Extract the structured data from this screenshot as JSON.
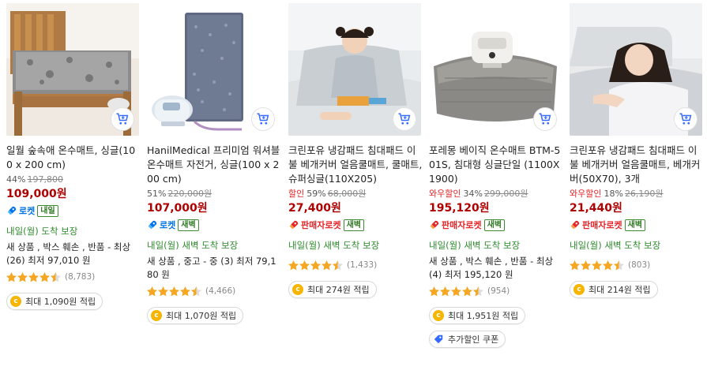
{
  "colors": {
    "price": "#ae0000",
    "sale": "#e52528",
    "rocket": "#0073e9",
    "delivery": "#2e8b2e",
    "star": "#f5a623"
  },
  "products": [
    {
      "title": "일월 숲속애 온수매트, 싱글(100 x 200 cm)",
      "sale_label": "",
      "discount": "44%",
      "original_price": "197,800",
      "price": "109,000원",
      "badge_type": "rocket",
      "badge_label": "로켓",
      "tag": "내일",
      "delivery": "내일(월) 도착 보장",
      "used_text": "새 상품 , 박스 훼손 , 반품 - 최상 (26) 최저 97,010 원",
      "rating": 4.5,
      "review_count": "(8,783)",
      "points": "최대 1,090원 적립",
      "coupon": ""
    },
    {
      "title": "HanilMedical 프리미엄 워셔블 온수매트 자전거, 싱글(100 x 200 cm)",
      "sale_label": "",
      "discount": "51%",
      "original_price": "220,000원",
      "price": "107,000원",
      "badge_type": "rocket",
      "badge_label": "로켓",
      "tag": "새벽",
      "delivery": "내일(월) 새벽 도착 보장",
      "used_text": "새 상품 , 중고 - 중 (3) 최저 79,180 원",
      "rating": 4.5,
      "review_count": "(4,466)",
      "points": "최대 1,070원 적립",
      "coupon": ""
    },
    {
      "title": "크린포유 냉감패드 침대패드 이불 베개커버 얼음쿨매트, 쿨매트, 슈퍼싱글(110X205)",
      "sale_label": "할인",
      "discount": "59%",
      "original_price": "68,000원",
      "price": "27,400원",
      "badge_type": "seller",
      "badge_label": "판매자로켓",
      "tag": "새벽",
      "delivery": "내일(월) 새벽 도착 보장",
      "used_text": "",
      "rating": 4.5,
      "review_count": "(1,433)",
      "points": "최대 274원 적립",
      "coupon": ""
    },
    {
      "title": "포레몽 베이직 온수매트 BTM-501S, 침대형 싱글단일 (1100X1900)",
      "sale_label": "와우할인",
      "discount": "34%",
      "original_price": "299,000원",
      "price": "195,120원",
      "badge_type": "seller",
      "badge_label": "판매자로켓",
      "tag": "새벽",
      "delivery": "내일(월) 새벽 도착 보장",
      "used_text": "새 상품 , 박스 훼손 , 반품 - 최상 (4) 최저 195,120 원",
      "rating": 4.5,
      "review_count": "(954)",
      "points": "최대 1,951원 적립",
      "coupon": "추가할인 쿠폰"
    },
    {
      "title": "크린포유 냉감패드 침대패드 이불 베개커버 얼음쿨매트, 베개커버(50X70), 3개",
      "sale_label": "와우할인",
      "discount": "18%",
      "original_price": "26,190원",
      "price": "21,440원",
      "badge_type": "seller",
      "badge_label": "판매자로켓",
      "tag": "새벽",
      "delivery": "내일(월) 새벽 도착 보장",
      "used_text": "",
      "rating": 4.5,
      "review_count": "(803)",
      "points": "최대 214원 적립",
      "coupon": ""
    }
  ]
}
